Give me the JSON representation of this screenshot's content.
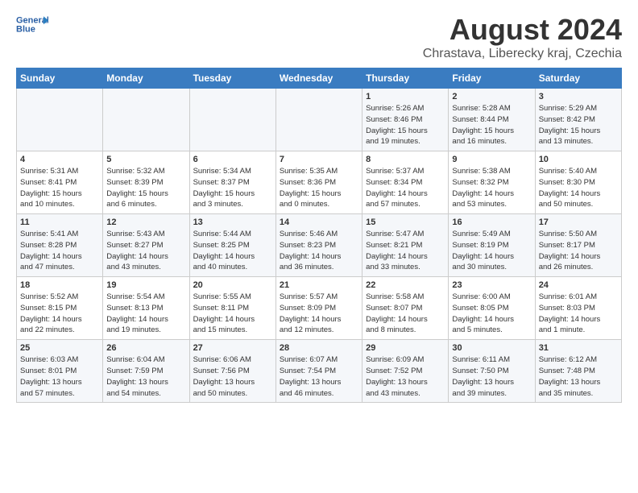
{
  "header": {
    "logo_line1": "General",
    "logo_line2": "Blue",
    "month": "August 2024",
    "location": "Chrastava, Liberecky kraj, Czechia"
  },
  "weekdays": [
    "Sunday",
    "Monday",
    "Tuesday",
    "Wednesday",
    "Thursday",
    "Friday",
    "Saturday"
  ],
  "weeks": [
    [
      {
        "day": "",
        "info": ""
      },
      {
        "day": "",
        "info": ""
      },
      {
        "day": "",
        "info": ""
      },
      {
        "day": "",
        "info": ""
      },
      {
        "day": "1",
        "info": "Sunrise: 5:26 AM\nSunset: 8:46 PM\nDaylight: 15 hours\nand 19 minutes."
      },
      {
        "day": "2",
        "info": "Sunrise: 5:28 AM\nSunset: 8:44 PM\nDaylight: 15 hours\nand 16 minutes."
      },
      {
        "day": "3",
        "info": "Sunrise: 5:29 AM\nSunset: 8:42 PM\nDaylight: 15 hours\nand 13 minutes."
      }
    ],
    [
      {
        "day": "4",
        "info": "Sunrise: 5:31 AM\nSunset: 8:41 PM\nDaylight: 15 hours\nand 10 minutes."
      },
      {
        "day": "5",
        "info": "Sunrise: 5:32 AM\nSunset: 8:39 PM\nDaylight: 15 hours\nand 6 minutes."
      },
      {
        "day": "6",
        "info": "Sunrise: 5:34 AM\nSunset: 8:37 PM\nDaylight: 15 hours\nand 3 minutes."
      },
      {
        "day": "7",
        "info": "Sunrise: 5:35 AM\nSunset: 8:36 PM\nDaylight: 15 hours\nand 0 minutes."
      },
      {
        "day": "8",
        "info": "Sunrise: 5:37 AM\nSunset: 8:34 PM\nDaylight: 14 hours\nand 57 minutes."
      },
      {
        "day": "9",
        "info": "Sunrise: 5:38 AM\nSunset: 8:32 PM\nDaylight: 14 hours\nand 53 minutes."
      },
      {
        "day": "10",
        "info": "Sunrise: 5:40 AM\nSunset: 8:30 PM\nDaylight: 14 hours\nand 50 minutes."
      }
    ],
    [
      {
        "day": "11",
        "info": "Sunrise: 5:41 AM\nSunset: 8:28 PM\nDaylight: 14 hours\nand 47 minutes."
      },
      {
        "day": "12",
        "info": "Sunrise: 5:43 AM\nSunset: 8:27 PM\nDaylight: 14 hours\nand 43 minutes."
      },
      {
        "day": "13",
        "info": "Sunrise: 5:44 AM\nSunset: 8:25 PM\nDaylight: 14 hours\nand 40 minutes."
      },
      {
        "day": "14",
        "info": "Sunrise: 5:46 AM\nSunset: 8:23 PM\nDaylight: 14 hours\nand 36 minutes."
      },
      {
        "day": "15",
        "info": "Sunrise: 5:47 AM\nSunset: 8:21 PM\nDaylight: 14 hours\nand 33 minutes."
      },
      {
        "day": "16",
        "info": "Sunrise: 5:49 AM\nSunset: 8:19 PM\nDaylight: 14 hours\nand 30 minutes."
      },
      {
        "day": "17",
        "info": "Sunrise: 5:50 AM\nSunset: 8:17 PM\nDaylight: 14 hours\nand 26 minutes."
      }
    ],
    [
      {
        "day": "18",
        "info": "Sunrise: 5:52 AM\nSunset: 8:15 PM\nDaylight: 14 hours\nand 22 minutes."
      },
      {
        "day": "19",
        "info": "Sunrise: 5:54 AM\nSunset: 8:13 PM\nDaylight: 14 hours\nand 19 minutes."
      },
      {
        "day": "20",
        "info": "Sunrise: 5:55 AM\nSunset: 8:11 PM\nDaylight: 14 hours\nand 15 minutes."
      },
      {
        "day": "21",
        "info": "Sunrise: 5:57 AM\nSunset: 8:09 PM\nDaylight: 14 hours\nand 12 minutes."
      },
      {
        "day": "22",
        "info": "Sunrise: 5:58 AM\nSunset: 8:07 PM\nDaylight: 14 hours\nand 8 minutes."
      },
      {
        "day": "23",
        "info": "Sunrise: 6:00 AM\nSunset: 8:05 PM\nDaylight: 14 hours\nand 5 minutes."
      },
      {
        "day": "24",
        "info": "Sunrise: 6:01 AM\nSunset: 8:03 PM\nDaylight: 14 hours\nand 1 minute."
      }
    ],
    [
      {
        "day": "25",
        "info": "Sunrise: 6:03 AM\nSunset: 8:01 PM\nDaylight: 13 hours\nand 57 minutes."
      },
      {
        "day": "26",
        "info": "Sunrise: 6:04 AM\nSunset: 7:59 PM\nDaylight: 13 hours\nand 54 minutes."
      },
      {
        "day": "27",
        "info": "Sunrise: 6:06 AM\nSunset: 7:56 PM\nDaylight: 13 hours\nand 50 minutes."
      },
      {
        "day": "28",
        "info": "Sunrise: 6:07 AM\nSunset: 7:54 PM\nDaylight: 13 hours\nand 46 minutes."
      },
      {
        "day": "29",
        "info": "Sunrise: 6:09 AM\nSunset: 7:52 PM\nDaylight: 13 hours\nand 43 minutes."
      },
      {
        "day": "30",
        "info": "Sunrise: 6:11 AM\nSunset: 7:50 PM\nDaylight: 13 hours\nand 39 minutes."
      },
      {
        "day": "31",
        "info": "Sunrise: 6:12 AM\nSunset: 7:48 PM\nDaylight: 13 hours\nand 35 minutes."
      }
    ]
  ]
}
